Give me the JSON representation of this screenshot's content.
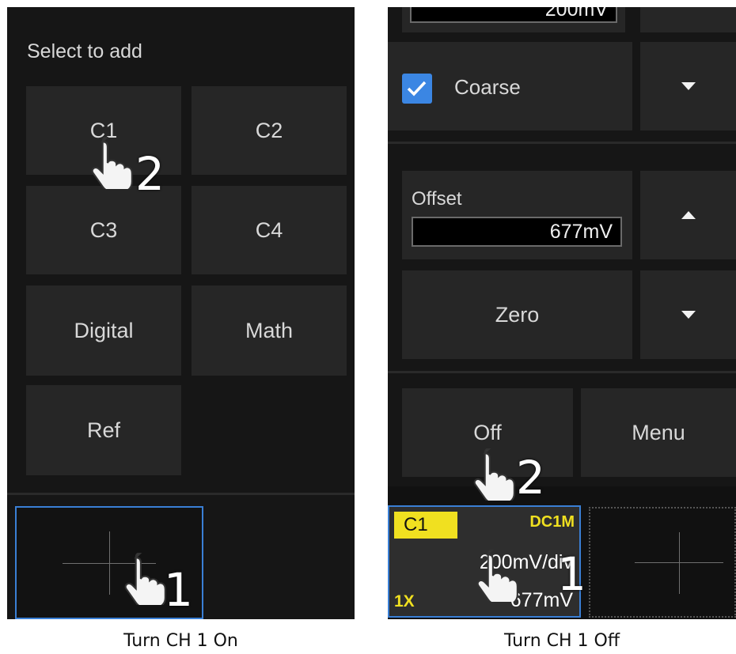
{
  "left": {
    "heading": "Select to add",
    "buttons": [
      "C1",
      "C2",
      "C3",
      "C4",
      "Digital",
      "Math",
      "Ref"
    ],
    "step_labels": [
      "2",
      "1"
    ],
    "caption": "Turn CH 1 On"
  },
  "right": {
    "top_value": "200mV",
    "coarse_label": "Coarse",
    "coarse_checked": true,
    "offset_label": "Offset",
    "offset_value": "677mV",
    "zero_label": "Zero",
    "off_label": "Off",
    "menu_label": "Menu",
    "channel": {
      "name": "C1",
      "coupling": "DC1M",
      "scale": "200mV/div",
      "probe": "1X",
      "offset": "677mV"
    },
    "step_labels": [
      "2",
      "1"
    ],
    "caption": "Turn CH 1 Off"
  },
  "colors": {
    "background": "#161616",
    "button": "#262626",
    "accent_blue": "#3a7fd5",
    "channel_yellow": "#f0e020"
  }
}
